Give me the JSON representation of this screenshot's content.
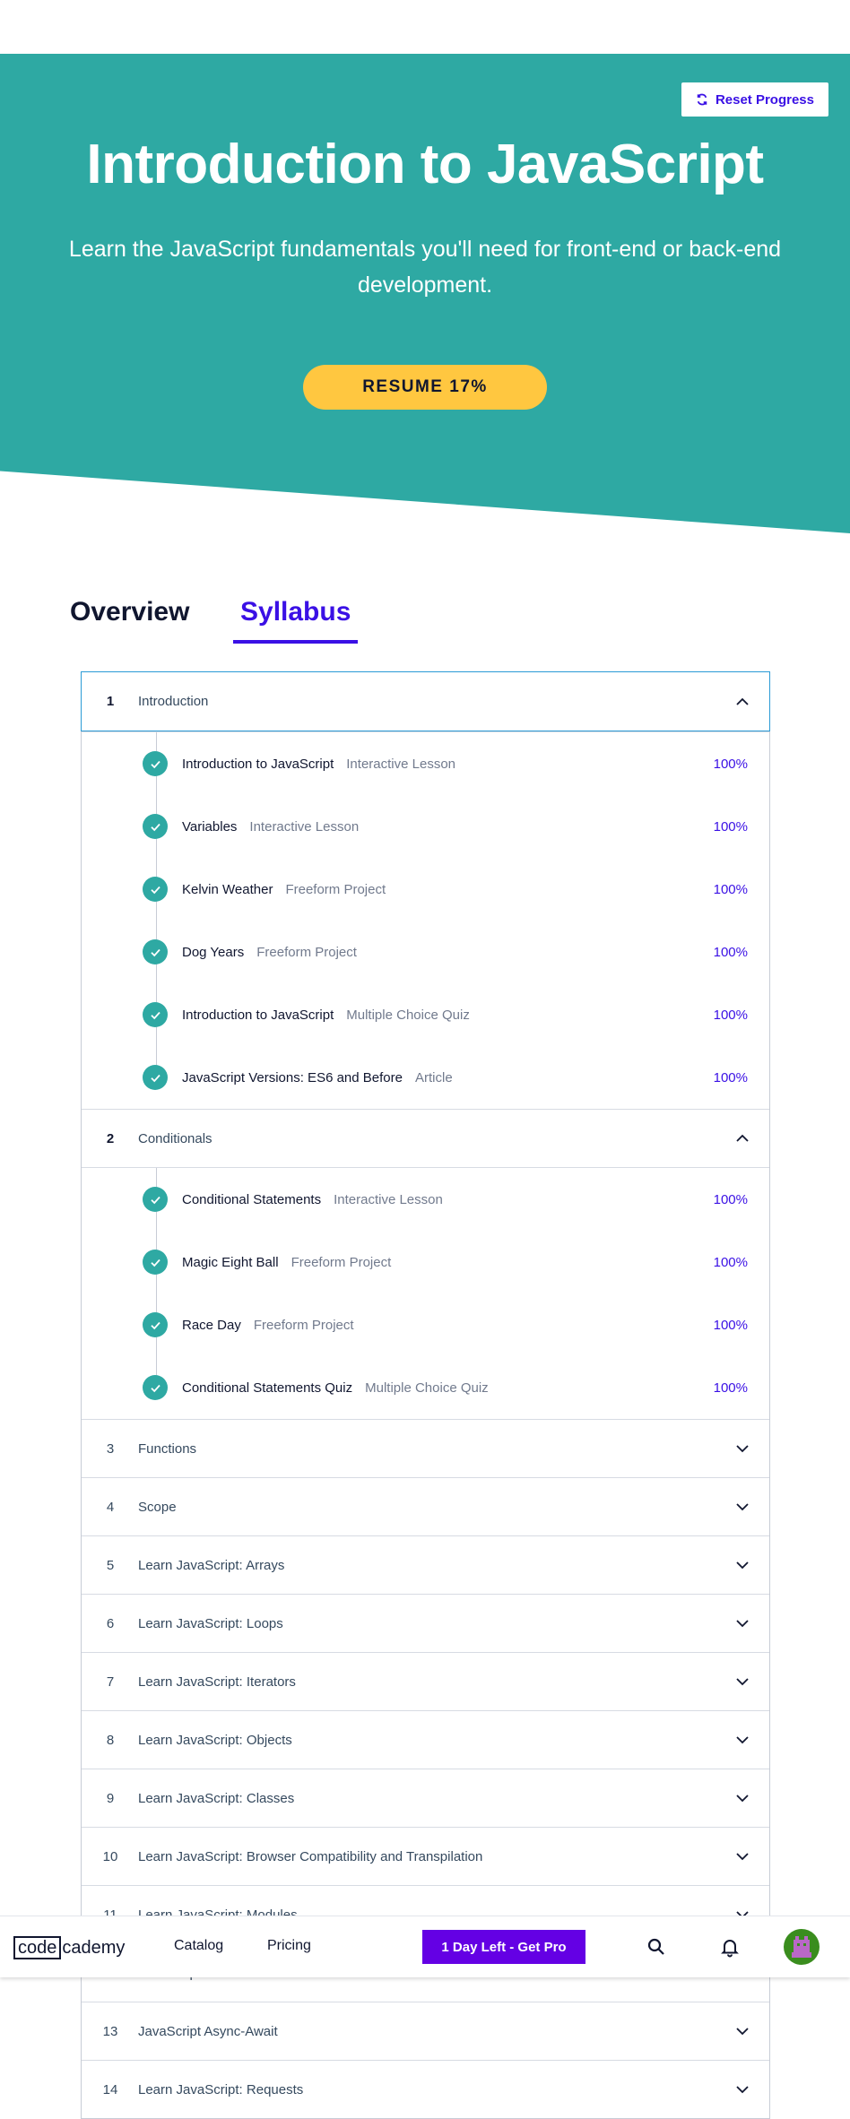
{
  "hero": {
    "reset_label": "Reset Progress",
    "title": "Introduction to JavaScript",
    "subtitle": "Learn the JavaScript fundamentals you'll need for front-end or back-end development.",
    "resume_label": "RESUME 17%",
    "bg_color": "#2ea9a3",
    "button_color": "#ffc740"
  },
  "tabs": {
    "overview": "Overview",
    "syllabus": "Syllabus",
    "active": "Syllabus"
  },
  "modules": [
    {
      "num": "1",
      "title": "Introduction",
      "expanded": true,
      "items": [
        {
          "title": "Introduction to JavaScript",
          "type": "Interactive Lesson",
          "progress": "100%"
        },
        {
          "title": "Variables",
          "type": "Interactive Lesson",
          "progress": "100%"
        },
        {
          "title": "Kelvin Weather",
          "type": "Freeform Project",
          "progress": "100%"
        },
        {
          "title": "Dog Years",
          "type": "Freeform Project",
          "progress": "100%"
        },
        {
          "title": "Introduction to JavaScript",
          "type": "Multiple Choice Quiz",
          "progress": "100%"
        },
        {
          "title": "JavaScript Versions: ES6 and Before",
          "type": "Article",
          "progress": "100%"
        }
      ]
    },
    {
      "num": "2",
      "title": "Conditionals",
      "expanded": true,
      "items": [
        {
          "title": "Conditional Statements",
          "type": "Interactive Lesson",
          "progress": "100%"
        },
        {
          "title": "Magic Eight Ball",
          "type": "Freeform Project",
          "progress": "100%"
        },
        {
          "title": "Race Day",
          "type": "Freeform Project",
          "progress": "100%"
        },
        {
          "title": "Conditional Statements Quiz",
          "type": "Multiple Choice Quiz",
          "progress": "100%"
        }
      ]
    },
    {
      "num": "3",
      "title": "Functions",
      "expanded": false,
      "items": []
    },
    {
      "num": "4",
      "title": "Scope",
      "expanded": false,
      "items": []
    },
    {
      "num": "5",
      "title": "Learn JavaScript: Arrays",
      "expanded": false,
      "items": []
    },
    {
      "num": "6",
      "title": "Learn JavaScript: Loops",
      "expanded": false,
      "items": []
    },
    {
      "num": "7",
      "title": "Learn JavaScript: Iterators",
      "expanded": false,
      "items": []
    },
    {
      "num": "8",
      "title": "Learn JavaScript: Objects",
      "expanded": false,
      "items": []
    },
    {
      "num": "9",
      "title": "Learn JavaScript: Classes",
      "expanded": false,
      "items": []
    },
    {
      "num": "10",
      "title": "Learn JavaScript: Browser Compatibility and Transpilation",
      "expanded": false,
      "items": []
    },
    {
      "num": "11",
      "title": "Learn JavaScript: Modules",
      "expanded": false,
      "items": []
    },
    {
      "num": "12",
      "title": "JavaScript Promises",
      "expanded": false,
      "items": []
    },
    {
      "num": "13",
      "title": "JavaScript Async-Await",
      "expanded": false,
      "items": []
    },
    {
      "num": "14",
      "title": "Learn JavaScript: Requests",
      "expanded": false,
      "items": []
    }
  ],
  "nav": {
    "logo_box": "code",
    "logo_rest": "cademy",
    "catalog": "Catalog",
    "pricing": "Pricing",
    "pro_label": "1 Day Left - Get Pro",
    "pro_color": "#6400e4",
    "search_icon": "search-icon",
    "bell_icon": "bell-icon"
  },
  "colors": {
    "accent": "#3a10e5",
    "complete": "#2ea9a3"
  }
}
